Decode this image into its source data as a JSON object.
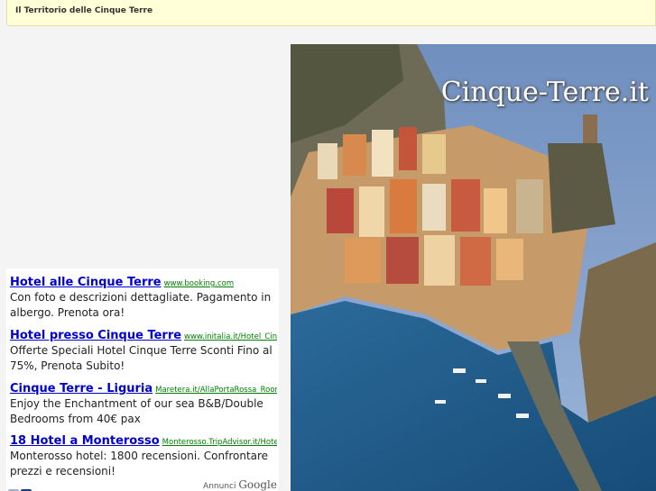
{
  "header": {
    "title": "Il Territorio delle Cinque Terre"
  },
  "hero": {
    "watermark": "Cinque-Terre.it"
  },
  "ads": [
    {
      "title": "Hotel alle Cinque Terre",
      "url": "www.booking.com",
      "desc": "Con foto e descrizioni dettagliate. Pagamento in albergo. Prenota ora!"
    },
    {
      "title": "Hotel presso Cinque Terre",
      "url": "www.initalia.it/Hotel_CinqueTerre",
      "desc": "Offerte Speciali Hotel Cinque Terre Sconti Fino al 75%, Prenota Subito!"
    },
    {
      "title": "Cinque Terre - Liguria",
      "url": "Maretera.it/AllaPortaRossa_Rooms",
      "desc": "Enjoy the Enchantment of our sea B&B/Double Bedrooms from 40€ pax"
    },
    {
      "title": "18 Hotel a Monterosso",
      "url": "Monterosso.TripAdvisor.it/Hotel",
      "desc": "Monterosso hotel: 1800 recensioni. Confrontare prezzi e recensioni!"
    }
  ],
  "adfooter": {
    "label": "Annunci",
    "brand": "Google",
    "prev_icon": "arrow-left-icon",
    "next_icon": "arrow-right-icon"
  }
}
